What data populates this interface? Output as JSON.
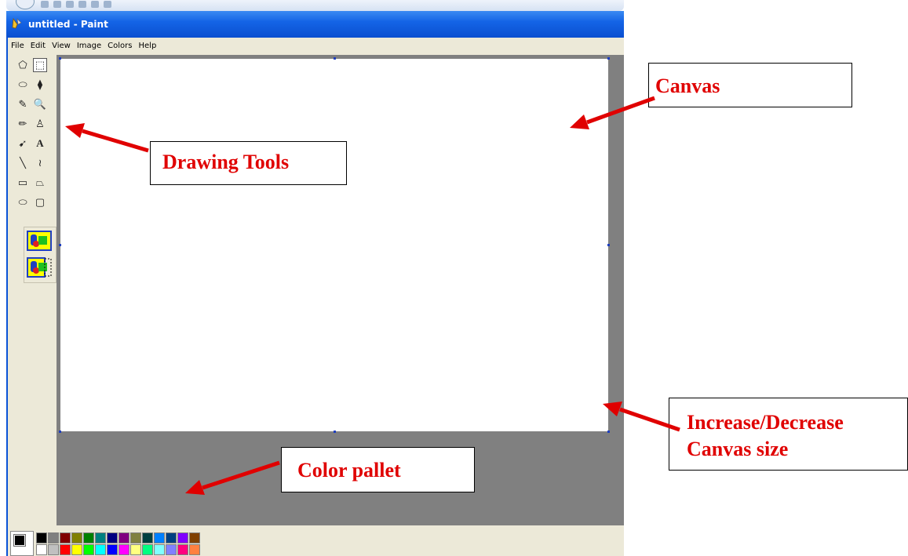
{
  "window": {
    "title": "untitled - Paint"
  },
  "menu": [
    "File",
    "Edit",
    "View",
    "Image",
    "Colors",
    "Help"
  ],
  "tools": [
    [
      "free-form-select-icon",
      "select-icon"
    ],
    [
      "eraser-icon",
      "fill-with-color-icon"
    ],
    [
      "pick-color-icon",
      "magnifier-icon"
    ],
    [
      "pencil-icon",
      "brush-icon"
    ],
    [
      "airbrush-icon",
      "text-icon"
    ],
    [
      "line-icon",
      "curve-icon"
    ],
    [
      "rectangle-icon",
      "polygon-icon"
    ],
    [
      "ellipse-icon",
      "rounded-rectangle-icon"
    ]
  ],
  "tool_glyphs": [
    "⬠",
    "⬚",
    "⬭",
    "⧫",
    "✎",
    "🔍",
    "✏",
    "♙",
    "➹",
    "A",
    "╲",
    "≀",
    "▭",
    "⏢",
    "⬭",
    "▢"
  ],
  "palette": {
    "foreground": "#000000",
    "background": "#ffffff",
    "top_row": [
      "#000000",
      "#808080",
      "#800000",
      "#808000",
      "#008000",
      "#008080",
      "#000080",
      "#800080",
      "#808040",
      "#004040",
      "#0080ff",
      "#004080",
      "#8000ff",
      "#804000"
    ],
    "bottom_row": [
      "#ffffff",
      "#c0c0c0",
      "#ff0000",
      "#ffff00",
      "#00ff00",
      "#00ffff",
      "#0000ff",
      "#ff00ff",
      "#ffff80",
      "#00ff80",
      "#80ffff",
      "#8080ff",
      "#ff0080",
      "#ff8040"
    ]
  },
  "annotations": {
    "canvas": "Canvas",
    "drawing_tools": "Drawing Tools",
    "resize_line1": "Increase/Decrease",
    "resize_line2": "Canvas size",
    "color_pallet": "Color pallet"
  },
  "colors": {
    "annotation_red": "#e00000",
    "workspace_grey": "#808080",
    "titlebar_blue": "#0a53d6"
  }
}
